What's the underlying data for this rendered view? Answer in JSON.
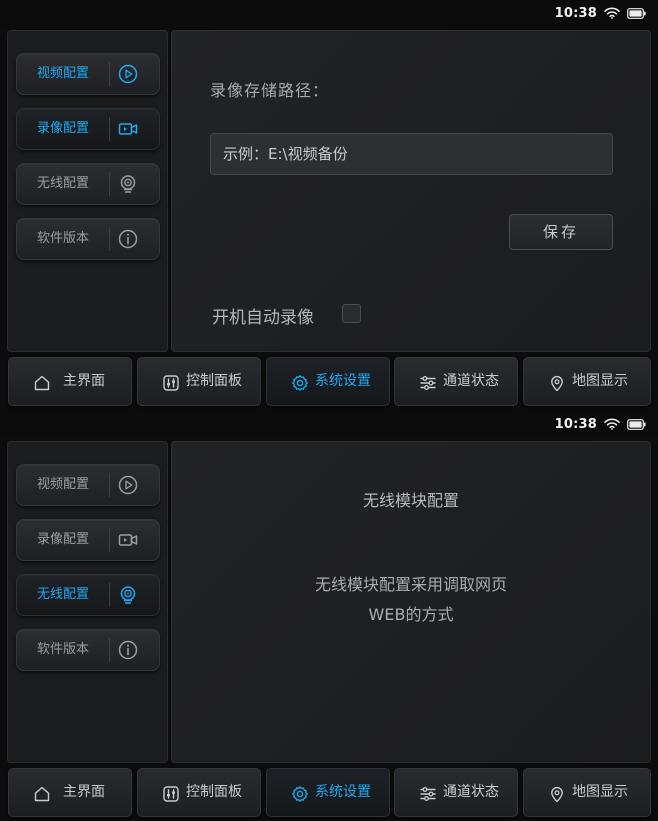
{
  "status_bar": {
    "time": "10:38"
  },
  "side_menu": {
    "items": [
      {
        "label": "视频配置",
        "icon": "play-circle-icon"
      },
      {
        "label": "录像配置",
        "icon": "video-camera-icon"
      },
      {
        "label": "无线配置",
        "icon": "wireless-antenna-icon"
      },
      {
        "label": "软件版本",
        "icon": "info-circle-icon"
      }
    ]
  },
  "recording_config": {
    "path_label": "录像存储路径：",
    "path_placeholder": "示例：E:\\视频备份",
    "save_label": "保存",
    "autorec_label": "开机自动录像",
    "autorec_checked": false
  },
  "wireless_config": {
    "title": "无线模块配置",
    "desc_line1": "无线模块配置采用调取网页",
    "desc_line2": "WEB的方式"
  },
  "bottom_nav": {
    "items": [
      {
        "label": "主界面",
        "icon": "home-icon"
      },
      {
        "label": "控制面板",
        "icon": "control-panel-icon"
      },
      {
        "label": "系统设置",
        "icon": "gear-icon"
      },
      {
        "label": "通道状态",
        "icon": "sliders-icon"
      },
      {
        "label": "地图显示",
        "icon": "map-pin-icon"
      }
    ],
    "active_index": 2
  },
  "colors": {
    "accent": "#1ea9f2",
    "background": "#0c0c0d",
    "panel": "#1b1c1e"
  }
}
